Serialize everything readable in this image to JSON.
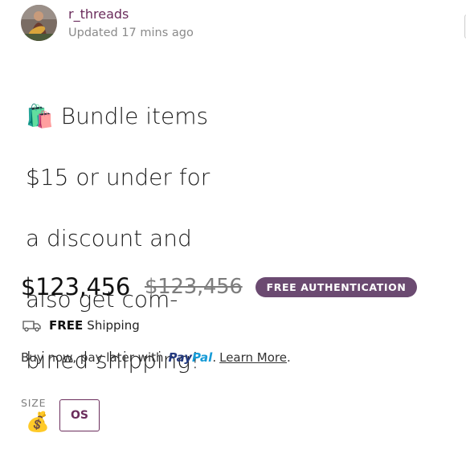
{
  "seller": {
    "username": "r_threads",
    "updated": "Updated 17 mins ago"
  },
  "listing": {
    "title_lines": [
      "🛍️ Bundle items",
      "$15 or under for",
      "a discount and",
      "also get com-",
      "bined shipping!",
      "💰"
    ],
    "price": "$123,456",
    "original_price": "$123,456",
    "badge": "FREE AUTHENTICATION"
  },
  "shipping": {
    "free": "FREE",
    "label": "Shipping"
  },
  "paypal": {
    "prefix": "Buy now, pay later with",
    "brand_pay": "Pay",
    "brand_pal": "Pal",
    "period": ".",
    "learn_more": "Learn More",
    "suffix": "."
  },
  "size": {
    "label": "SIZE",
    "value": "OS"
  },
  "colors": {
    "accent": "#6b2d5c",
    "badge_bg": "#6b4a71",
    "paypal_dark": "#253b80",
    "paypal_light": "#179bd7"
  },
  "icons": {
    "truck": "truck-icon",
    "avatar": "avatar"
  }
}
